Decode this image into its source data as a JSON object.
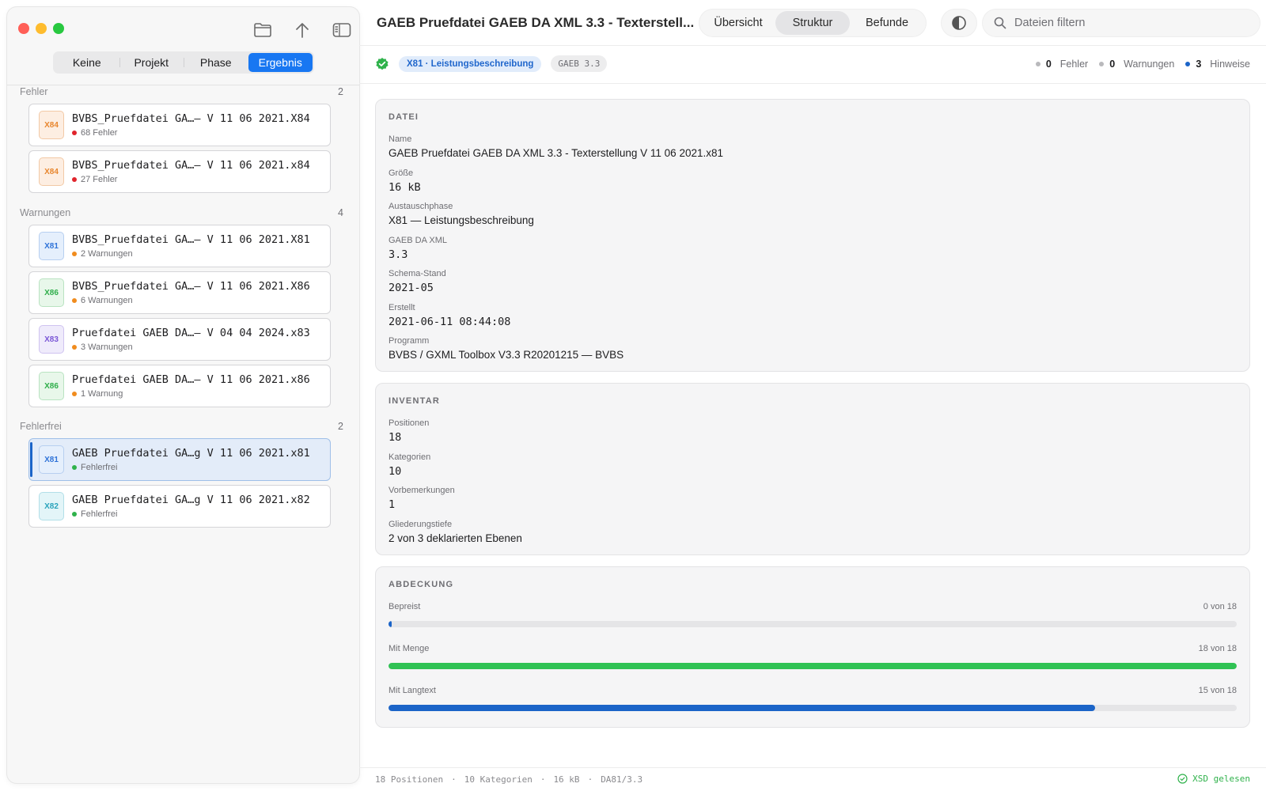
{
  "sidebar": {
    "segments": [
      "Keine",
      "Projekt",
      "Phase",
      "Ergebnis"
    ],
    "active_segment": "Ergebnis",
    "groups": [
      {
        "title": "Fehler",
        "count": "2",
        "items": [
          {
            "badge": "X84",
            "name": "BVBS_Pruefdatei GA…– V 11 06 2021.X84",
            "status": "68 Fehler",
            "status_color": "red"
          },
          {
            "badge": "X84",
            "name": "BVBS_Pruefdatei GA…– V 11 06 2021.x84",
            "status": "27 Fehler",
            "status_color": "red"
          }
        ]
      },
      {
        "title": "Warnungen",
        "count": "4",
        "items": [
          {
            "badge": "X81",
            "name": "BVBS_Pruefdatei GA…– V 11 06 2021.X81",
            "status": "2 Warnungen",
            "status_color": "orange"
          },
          {
            "badge": "X86",
            "name": "BVBS_Pruefdatei GA…– V 11 06 2021.X86",
            "status": "6 Warnungen",
            "status_color": "orange"
          },
          {
            "badge": "X83",
            "name": "Pruefdatei GAEB DA…– V 04 04 2024.x83",
            "status": "3 Warnungen",
            "status_color": "orange"
          },
          {
            "badge": "X86",
            "name": "Pruefdatei GAEB DA…– V 11 06 2021.x86",
            "status": "1 Warnung",
            "status_color": "orange"
          }
        ]
      },
      {
        "title": "Fehlerfrei",
        "count": "2",
        "items": [
          {
            "badge": "X81",
            "name": "GAEB Pruefdatei GA…g V 11 06 2021.x81",
            "status": "Fehlerfrei",
            "status_color": "green",
            "selected": true
          },
          {
            "badge": "X82",
            "name": "GAEB Pruefdatei GA…g V 11 06 2021.x82",
            "status": "Fehlerfrei",
            "status_color": "green"
          }
        ]
      }
    ]
  },
  "header": {
    "title": "GAEB Pruefdatei GAEB DA XML 3.3 - Texterstell...",
    "tabs": [
      "Übersicht",
      "Struktur",
      "Befunde"
    ],
    "active_tab": "Struktur",
    "search_placeholder": "Dateien filtern"
  },
  "status": {
    "phase_pill": "X81 · Leistungsbeschreibung",
    "version_pill": "GAEB 3.3",
    "fehler_count": "0",
    "fehler_label": "Fehler",
    "warn_count": "0",
    "warn_label": "Warnungen",
    "hint_count": "3",
    "hint_label": "Hinweise"
  },
  "datei": {
    "heading": "DATEI",
    "fields": [
      {
        "label": "Name",
        "value": "GAEB Pruefdatei GAEB DA XML 3.3 - Texterstellung V 11 06 2021.x81",
        "mono": false
      },
      {
        "label": "Größe",
        "value": "16 kB",
        "mono": true
      },
      {
        "label": "Austauschphase",
        "value": "X81 — Leistungsbeschreibung",
        "mono": false
      },
      {
        "label": "GAEB DA XML",
        "value": "3.3",
        "mono": true
      },
      {
        "label": "Schema-Stand",
        "value": "2021-05",
        "mono": true
      },
      {
        "label": "Erstellt",
        "value": "2021-06-11 08:44:08",
        "mono": true
      },
      {
        "label": "Programm",
        "value": "BVBS / GXML Toolbox V3.3 R20201215 — BVBS",
        "mono": false
      }
    ]
  },
  "inventar": {
    "heading": "INVENTAR",
    "fields": [
      {
        "label": "Positionen",
        "value": "18",
        "mono": true
      },
      {
        "label": "Kategorien",
        "value": "10",
        "mono": true
      },
      {
        "label": "Vorbemerkungen",
        "value": "1",
        "mono": true
      },
      {
        "label": "Gliederungstiefe",
        "value": "2 von 3 deklarierten Ebenen",
        "mono": false
      }
    ]
  },
  "abdeckung": {
    "heading": "ABDECKUNG",
    "bars": [
      {
        "label": "Bepreist",
        "value_text": "0 von 18",
        "value": 0,
        "total": 18,
        "color": "#1b64c8"
      },
      {
        "label": "Mit Menge",
        "value_text": "18 von 18",
        "value": 18,
        "total": 18,
        "color": "#30c254"
      },
      {
        "label": "Mit Langtext",
        "value_text": "15 von 18",
        "value": 15,
        "total": 18,
        "color": "#1b64c8"
      }
    ]
  },
  "footer": {
    "items": [
      "18 Positionen",
      "·",
      "10 Kategorien",
      "·",
      "16 kB",
      "·",
      "DA81/3.3"
    ],
    "right": "XSD gelesen"
  },
  "colors": {
    "accent": "#1877f2",
    "error": "#e0242c",
    "warning": "#f08c1e",
    "ok": "#2fb24b"
  }
}
